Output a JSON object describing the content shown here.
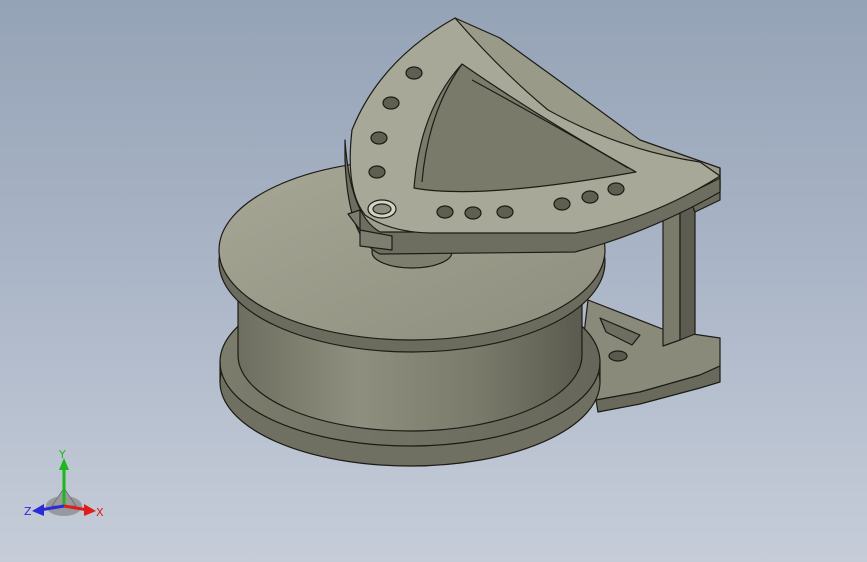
{
  "viewport": {
    "background_top": "#95a3b6",
    "background_bottom": "#c6cdd9"
  },
  "model": {
    "part_color": "#8c8c7c",
    "part_light": "#a9a998",
    "part_dark": "#5c5c50",
    "edge_color": "#1c1c16"
  },
  "triad": {
    "x_label": "X",
    "y_label": "Y",
    "z_label": "Z",
    "x_color": "#e11c1c",
    "y_color": "#1fb51f",
    "z_color": "#2a2ad6"
  }
}
